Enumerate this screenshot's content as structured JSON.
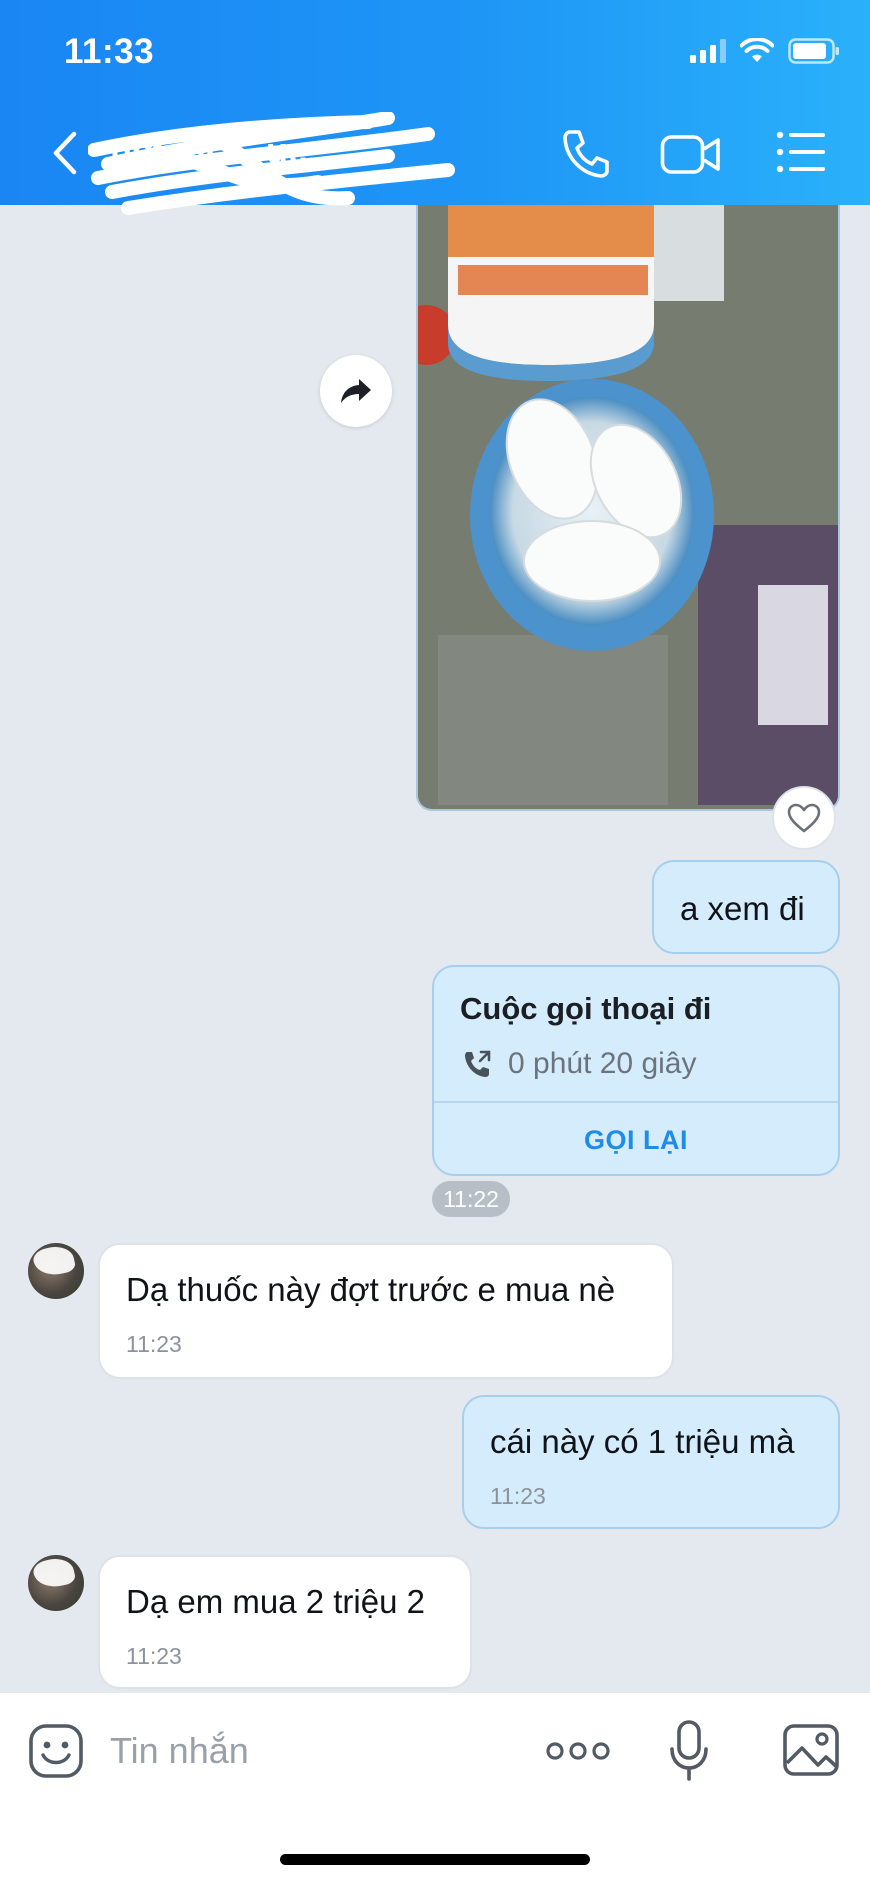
{
  "status_bar": {
    "time": "11:33"
  },
  "header": {
    "title": "ng...u...",
    "title_visible": "ng...uc... u..."
  },
  "photo": {
    "description_icon": "photo-attachment"
  },
  "messages": [
    {
      "direction": "out",
      "text": "a xem đi"
    },
    {
      "direction": "out",
      "type": "call",
      "title": "Cuộc gọi thoại đi",
      "duration": "0 phút 20 giây",
      "action": "GỌI LẠI"
    },
    {
      "type": "timestamp",
      "text": "11:22"
    },
    {
      "direction": "in",
      "text": "Dạ thuốc này đợt trước e mua nè",
      "time": "11:23"
    },
    {
      "direction": "out",
      "text": "cái này có 1 triệu mà",
      "time": "11:23"
    },
    {
      "direction": "in",
      "text": "Dạ em mua 2 triệu 2",
      "time": "11:23"
    }
  ],
  "composer": {
    "placeholder": "Tin nhắn"
  },
  "icons": {
    "back": "chevron-left-icon",
    "call": "phone-icon",
    "video": "video-camera-icon",
    "menu": "list-menu-icon",
    "share": "share-arrow-icon",
    "like": "heart-icon",
    "emoji": "emoji-icon",
    "more": "more-dots-icon",
    "mic": "microphone-icon",
    "gallery": "image-icon"
  },
  "colors": {
    "header_start": "#1a86f4",
    "header_end": "#2ab1fb",
    "outgoing_bubble": "#d5ecfc",
    "incoming_bubble": "#ffffff",
    "accent": "#1f8de8",
    "chat_bg": "#e4e8ef"
  }
}
